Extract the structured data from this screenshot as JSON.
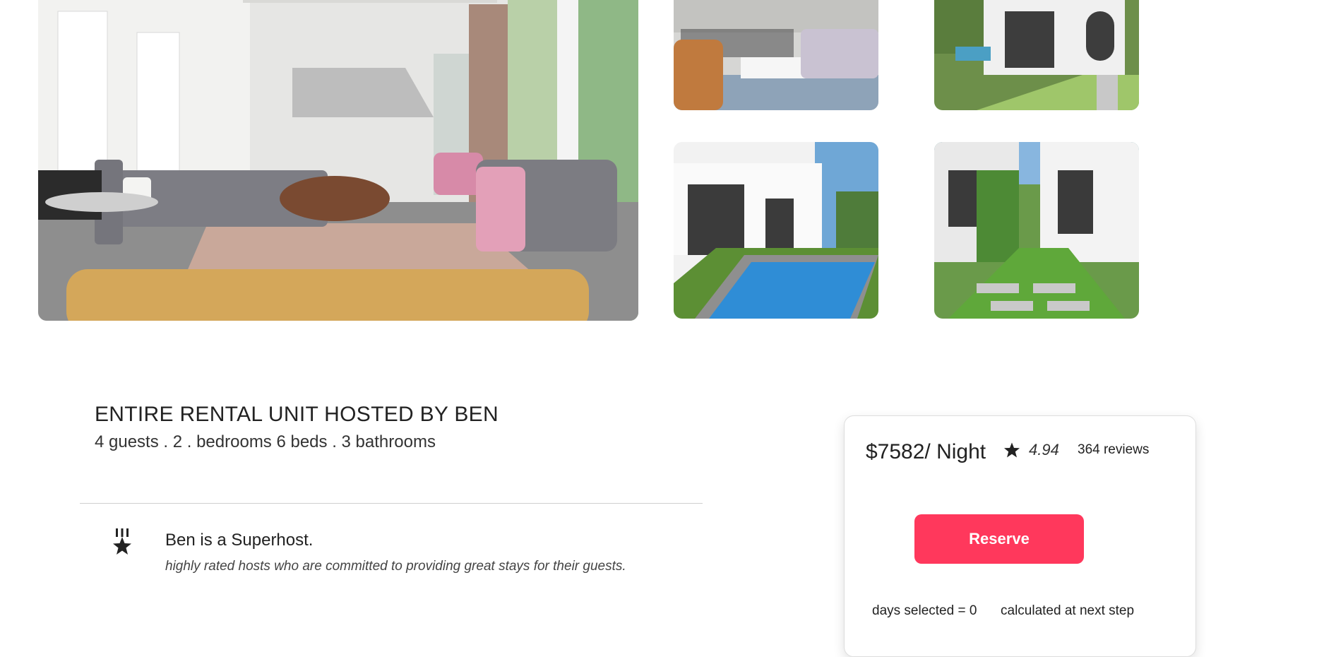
{
  "listing": {
    "title": "ENTIRE RENTAL UNIT HOSTED BY BEN",
    "details": "4 guests . 2 . bedrooms 6 beds . 3 bathrooms"
  },
  "host": {
    "headline": "Ben is a Superhost.",
    "description": "highly rated hosts who are committed to providing great stays for their guests.",
    "icon": "medal-icon"
  },
  "booking": {
    "price": "$7582/ Night",
    "rating": "4.94",
    "rating_icon": "star-icon",
    "reviews": "364 reviews",
    "reserve_label": "Reserve",
    "days_selected": "days selected = 0",
    "calc_note": "calculated at next step",
    "accent_color": "#ff385c"
  }
}
